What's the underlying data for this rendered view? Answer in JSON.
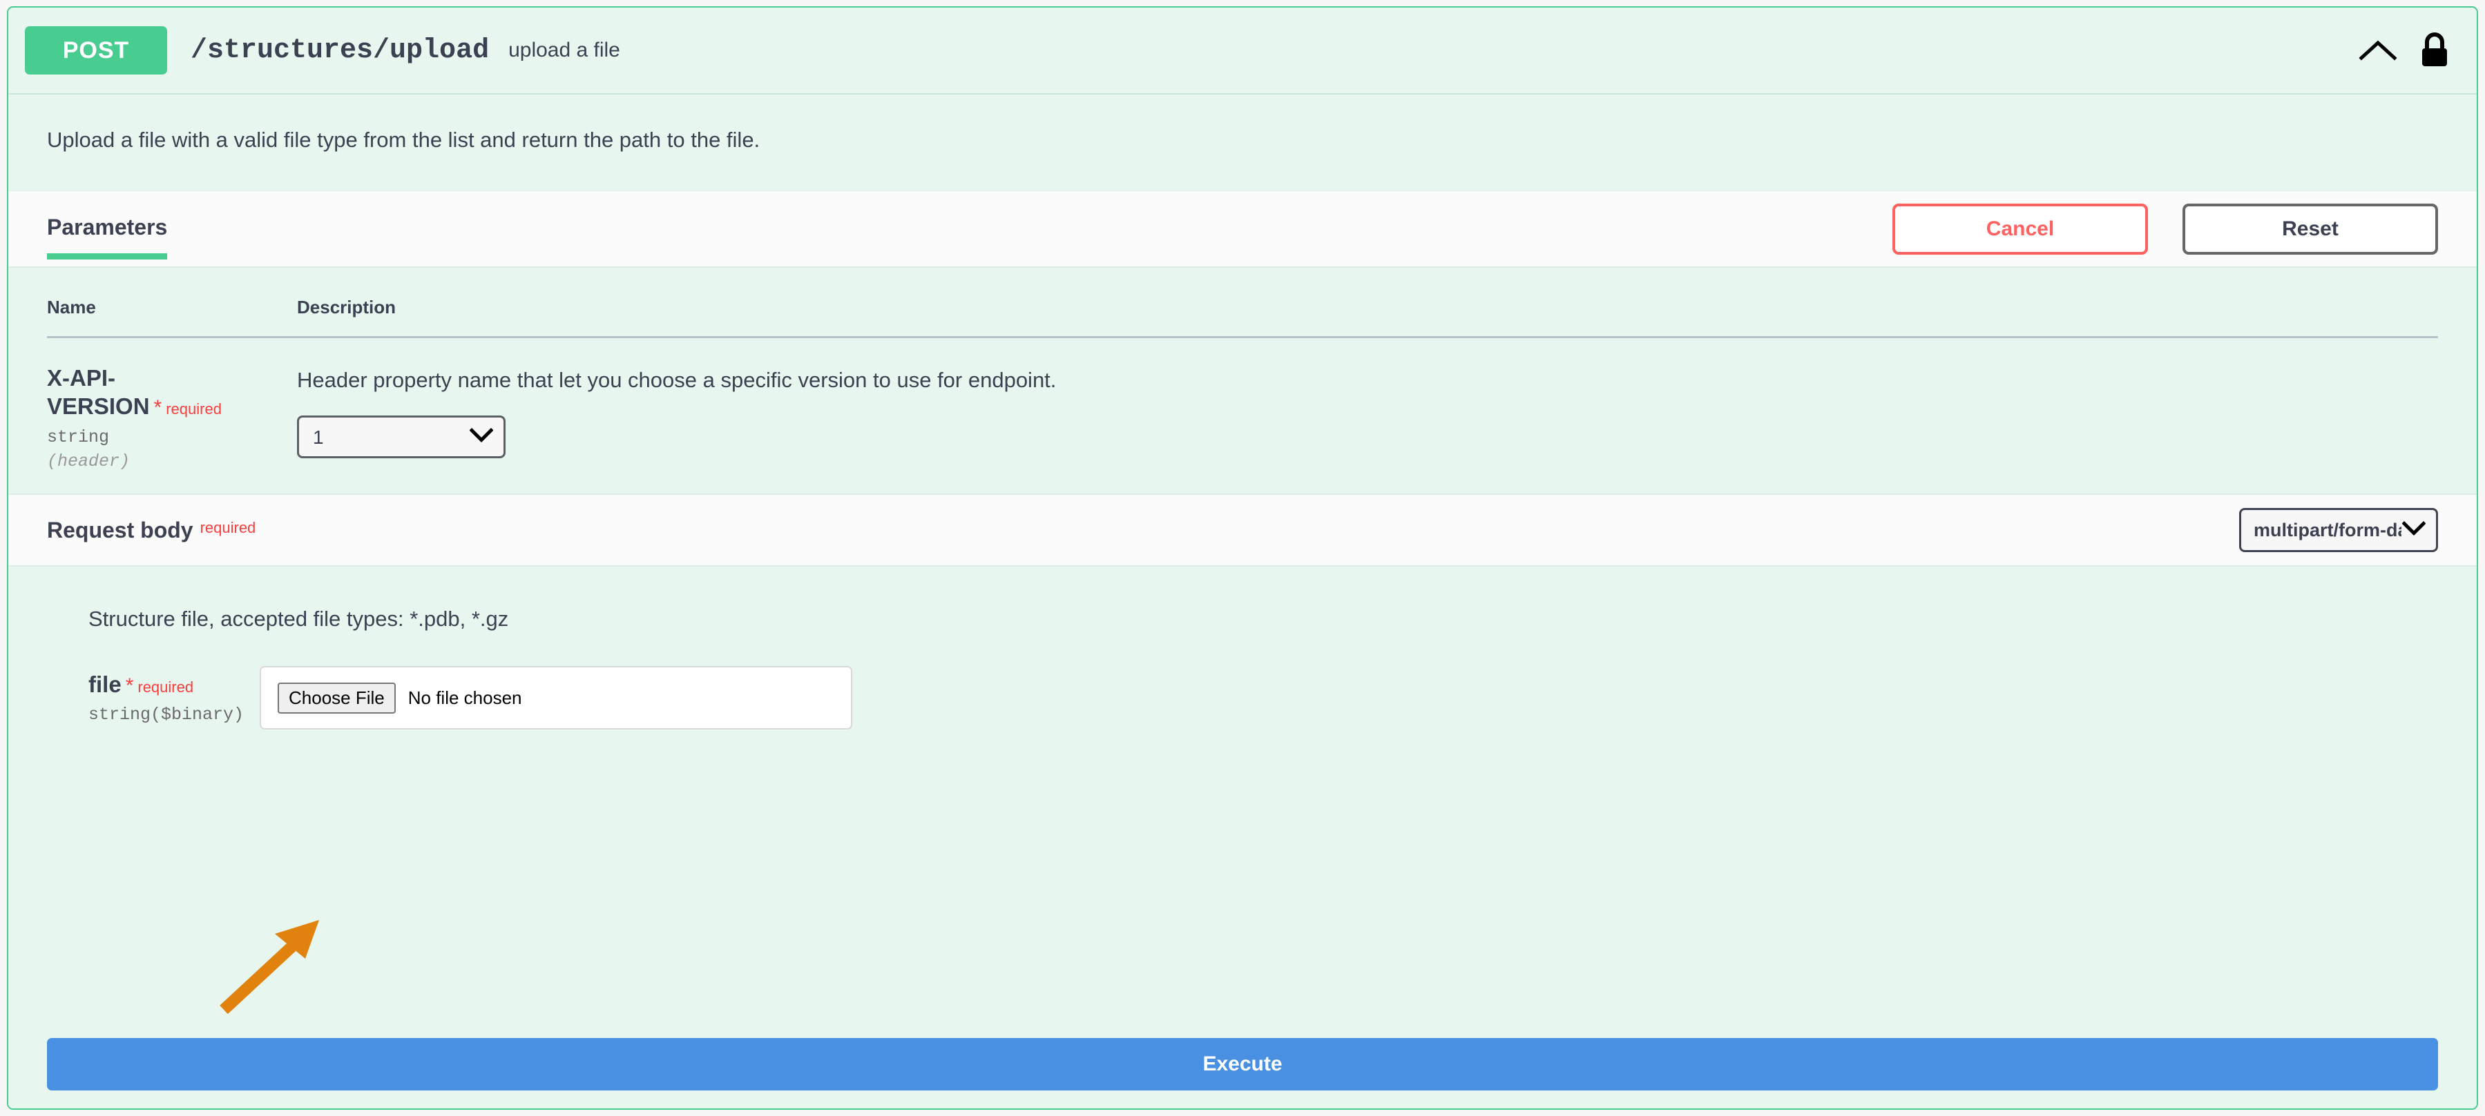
{
  "operation": {
    "method": "POST",
    "path": "/structures/upload",
    "summary": "upload a file",
    "description": "Upload a file with a valid file type from the list and return the path to the file.",
    "collapse_icon": "chevron-up-icon",
    "auth_icon": "lock-closed-icon"
  },
  "toolbar": {
    "tab_parameters": "Parameters",
    "cancel_label": "Cancel",
    "reset_label": "Reset"
  },
  "parameters_table": {
    "columns": {
      "name": "Name",
      "description": "Description"
    },
    "rows": [
      {
        "name": "X-API-VERSION",
        "required_star": "*",
        "required_label": "required",
        "type": "string",
        "in": "(header)",
        "description": "Header property name that let you choose a specific version to use for endpoint.",
        "control": {
          "kind": "select",
          "value": "1",
          "options": [
            "1"
          ],
          "arrow_icon": "chevron-down-icon"
        }
      }
    ]
  },
  "request_body": {
    "title": "Request body",
    "required_label": "required",
    "content_type": {
      "value": "multipart/form-data",
      "options": [
        "multipart/form-data"
      ],
      "arrow_icon": "chevron-down-icon"
    },
    "hint": "Structure file, accepted file types: *.pdb, *.gz",
    "field": {
      "name": "file",
      "required_star": "*",
      "required_label": "required",
      "type": "string($binary)",
      "choose_file_label": "Choose File",
      "no_file_text": "No file chosen"
    }
  },
  "annotation": {
    "arrow_color": "#e2820e",
    "points_to": "choose-file-button"
  },
  "execute": {
    "label": "Execute"
  },
  "colors": {
    "method_green": "#49cc90",
    "panel_bg": "#e8f6f0",
    "bar_bg": "#fbfbfb",
    "required_red": "#f93e3e",
    "cancel_red": "#ff6060",
    "execute_blue": "#4990e2",
    "text": "#3b4151"
  }
}
